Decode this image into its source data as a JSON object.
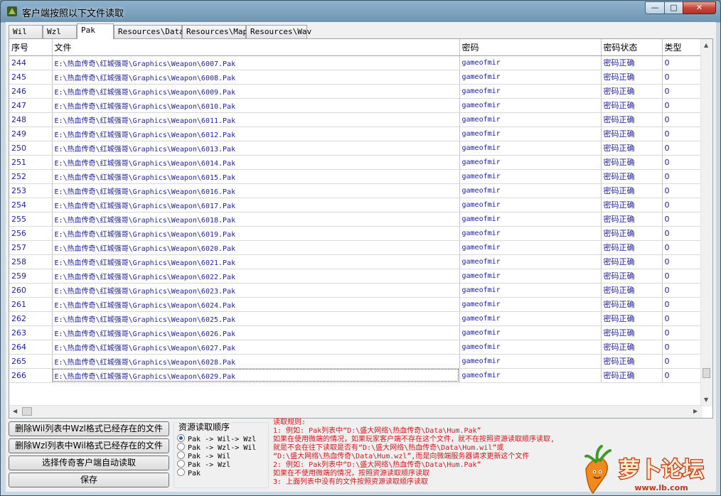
{
  "window": {
    "title": "客户端按照以下文件读取"
  },
  "tabs": [
    "Wil",
    "Wzl",
    "Pak",
    "Resources\\Data",
    "Resources\\Map",
    "Resources\\Wav"
  ],
  "active_tab": "Pak",
  "table": {
    "headers": [
      "序号",
      "文件",
      "密码",
      "密码状态",
      "类型"
    ],
    "rows": [
      {
        "no": "244",
        "file": "E:\\热血传奇\\红城强哥\\Graphics\\Weapon\\6007.Pak",
        "pw": "gameofmir",
        "status": "密码正确",
        "type": "0"
      },
      {
        "no": "245",
        "file": "E:\\热血传奇\\红城强哥\\Graphics\\Weapon\\6008.Pak",
        "pw": "gameofmir",
        "status": "密码正确",
        "type": "0"
      },
      {
        "no": "246",
        "file": "E:\\热血传奇\\红城强哥\\Graphics\\Weapon\\6009.Pak",
        "pw": "gameofmir",
        "status": "密码正确",
        "type": "0"
      },
      {
        "no": "247",
        "file": "E:\\热血传奇\\红城强哥\\Graphics\\Weapon\\6010.Pak",
        "pw": "gameofmir",
        "status": "密码正确",
        "type": "0"
      },
      {
        "no": "248",
        "file": "E:\\热血传奇\\红城强哥\\Graphics\\Weapon\\6011.Pak",
        "pw": "gameofmir",
        "status": "密码正确",
        "type": "0"
      },
      {
        "no": "249",
        "file": "E:\\热血传奇\\红城强哥\\Graphics\\Weapon\\6012.Pak",
        "pw": "gameofmir",
        "status": "密码正确",
        "type": "0"
      },
      {
        "no": "250",
        "file": "E:\\热血传奇\\红城强哥\\Graphics\\Weapon\\6013.Pak",
        "pw": "gameofmir",
        "status": "密码正确",
        "type": "0"
      },
      {
        "no": "251",
        "file": "E:\\热血传奇\\红城强哥\\Graphics\\Weapon\\6014.Pak",
        "pw": "gameofmir",
        "status": "密码正确",
        "type": "0"
      },
      {
        "no": "252",
        "file": "E:\\热血传奇\\红城强哥\\Graphics\\Weapon\\6015.Pak",
        "pw": "gameofmir",
        "status": "密码正确",
        "type": "0"
      },
      {
        "no": "253",
        "file": "E:\\热血传奇\\红城强哥\\Graphics\\Weapon\\6016.Pak",
        "pw": "gameofmir",
        "status": "密码正确",
        "type": "0"
      },
      {
        "no": "254",
        "file": "E:\\热血传奇\\红城强哥\\Graphics\\Weapon\\6017.Pak",
        "pw": "gameofmir",
        "status": "密码正确",
        "type": "0"
      },
      {
        "no": "255",
        "file": "E:\\热血传奇\\红城强哥\\Graphics\\Weapon\\6018.Pak",
        "pw": "gameofmir",
        "status": "密码正确",
        "type": "0"
      },
      {
        "no": "256",
        "file": "E:\\热血传奇\\红城强哥\\Graphics\\Weapon\\6019.Pak",
        "pw": "gameofmir",
        "status": "密码正确",
        "type": "0"
      },
      {
        "no": "257",
        "file": "E:\\热血传奇\\红城强哥\\Graphics\\Weapon\\6020.Pak",
        "pw": "gameofmir",
        "status": "密码正确",
        "type": "0"
      },
      {
        "no": "258",
        "file": "E:\\热血传奇\\红城强哥\\Graphics\\Weapon\\6021.Pak",
        "pw": "gameofmir",
        "status": "密码正确",
        "type": "0"
      },
      {
        "no": "259",
        "file": "E:\\热血传奇\\红城强哥\\Graphics\\Weapon\\6022.Pak",
        "pw": "gameofmir",
        "status": "密码正确",
        "type": "0"
      },
      {
        "no": "260",
        "file": "E:\\热血传奇\\红城强哥\\Graphics\\Weapon\\6023.Pak",
        "pw": "gameofmir",
        "status": "密码正确",
        "type": "0"
      },
      {
        "no": "261",
        "file": "E:\\热血传奇\\红城强哥\\Graphics\\Weapon\\6024.Pak",
        "pw": "gameofmir",
        "status": "密码正确",
        "type": "0"
      },
      {
        "no": "262",
        "file": "E:\\热血传奇\\红城强哥\\Graphics\\Weapon\\6025.Pak",
        "pw": "gameofmir",
        "status": "密码正确",
        "type": "0"
      },
      {
        "no": "263",
        "file": "E:\\热血传奇\\红城强哥\\Graphics\\Weapon\\6026.Pak",
        "pw": "gameofmir",
        "status": "密码正确",
        "type": "0"
      },
      {
        "no": "264",
        "file": "E:\\热血传奇\\红城强哥\\Graphics\\Weapon\\6027.Pak",
        "pw": "gameofmir",
        "status": "密码正确",
        "type": "0"
      },
      {
        "no": "265",
        "file": "E:\\热血传奇\\红城强哥\\Graphics\\Weapon\\6028.Pak",
        "pw": "gameofmir",
        "status": "密码正确",
        "type": "0"
      },
      {
        "no": "266",
        "file": "E:\\热血传奇\\红城强哥\\Graphics\\Weapon\\6029.Pak",
        "pw": "gameofmir",
        "status": "密码正确",
        "type": "0"
      }
    ],
    "selected_row": "266"
  },
  "buttons": {
    "delete_wil": "删除Wil列表中Wzl格式已经存在的文件",
    "delete_wzl": "删除Wzl列表中Wil格式已经存在的文件",
    "select_client": "选择传奇客户端自动读取",
    "save": "保存"
  },
  "read_order": {
    "title": "资源读取顺序",
    "options": [
      "Pak -> Wil-> Wzl",
      "Pak -> Wzl-> Wil",
      "Pak -> Wil",
      "Pak -> Wzl",
      "Pak"
    ],
    "selected": 0
  },
  "rules": [
    "读取规则:",
    "1: 例如: Pak列表中“D:\\盛大网络\\热血传奇\\Data\\Hum.Pak”",
    "    如果在使用微端的情况，如果玩家客户端不存在这个文件，就不在按照资源读取顺序读取,",
    "    就是不会在往下读取是否有“D:\\盛大网络\\热血传奇\\Data\\Hum.wil”或",
    "  “D:\\盛大网络\\热血传奇\\Data\\Hum.wzl”,而是向微端服务器请求更新这个文件",
    "2: 例如: Pak列表中“D:\\盛大网络\\热血传奇\\Data\\Hum.Pak”",
    "    如果在不使用微端的情况，按照资源读取顺序读取",
    "3: 上面列表中没有的文件按照资源读取顺序读取"
  ],
  "watermark": {
    "text": "萝卜论坛",
    "url_text": "www.lb.com"
  },
  "colors": {
    "accent": "#1f1f9e",
    "rules_text": "#d8141a"
  },
  "icons": {
    "app": "game-app-icon",
    "minimize": "minimize-icon",
    "maximize": "maximize-icon",
    "close": "close-icon"
  }
}
